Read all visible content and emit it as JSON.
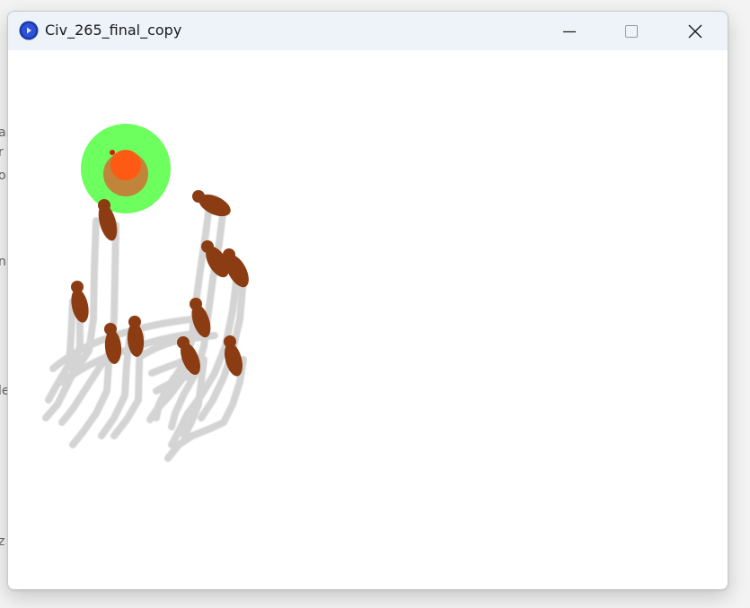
{
  "window": {
    "title": "Civ_265_final_copy",
    "app_icon": "processing-app-icon"
  },
  "controls": {
    "minimize_icon": "minimize-icon",
    "maximize_icon": "maximize-icon",
    "close_icon": "close-icon"
  },
  "background_fragments": [
    "ar",
    "r",
    "or",
    "n",
    "le",
    "z"
  ],
  "colors": {
    "titlebar": "#eef3f9",
    "target_outer": "#6cff5e",
    "target_mid": "#c0843a",
    "target_core": "#ff5a14",
    "agent_body": "#8b3c12",
    "trail": "#d0d0d0"
  }
}
